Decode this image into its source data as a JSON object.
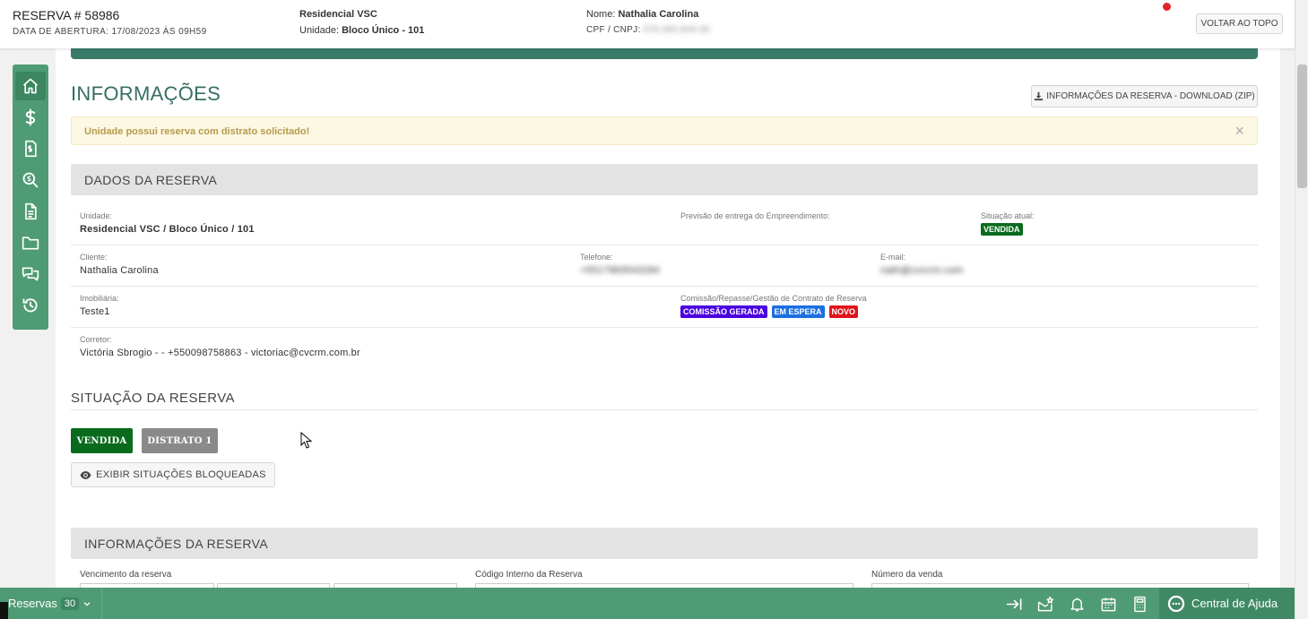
{
  "header": {
    "reserva_title": "RESERVA # 58986",
    "data_abertura": "DATA DE ABERTURA: 17/08/2023 ÀS 09H59",
    "empreendimento": "Residencial VSC",
    "unidade_label": "Unidade:",
    "unidade_value": "Bloco Único - 101",
    "nome_label": "Nome:",
    "nome_value": "Nathalia Carolina",
    "cpf_label": "CPF / CNPJ:",
    "cpf_value": "078.450.849-30",
    "voltar_label": "VOLTAR AO TOPO"
  },
  "sidebar": {
    "items": [
      {
        "name": "home-icon",
        "active": true
      },
      {
        "name": "dollar-icon",
        "active": false
      },
      {
        "name": "invoice-icon",
        "active": false
      },
      {
        "name": "search-dollar-icon",
        "active": false
      },
      {
        "name": "document-icon",
        "active": false
      },
      {
        "name": "folder-icon",
        "active": false
      },
      {
        "name": "chat-icon",
        "active": false
      },
      {
        "name": "history-icon",
        "active": false
      }
    ]
  },
  "main": {
    "title": "INFORMAÇÕES",
    "download_label": "INFORMAÇÕES DA RESERVA - DOWNLOAD (ZIP)",
    "alert_text": "Unidade possui reserva com distrato solicitado!",
    "alert_close": "×"
  },
  "dados": {
    "section_title": "DADOS DA RESERVA",
    "unidade_label": "Unidade:",
    "unidade_value": "Residencial VSC / Bloco Único / 101",
    "previsao_label": "Previsão de entrega do Empreendimento:",
    "situacao_label": "Situação atual:",
    "situacao_badge": "VENDIDA",
    "cliente_label": "Cliente:",
    "cliente_value": "Nathalia Carolina",
    "telefone_label": "Telefone:",
    "telefone_value": "+5517983543284",
    "email_label": "E-mail:",
    "email_value": "nath@cvrcrm.com",
    "imobiliaria_label": "Imobiliária:",
    "imobiliaria_value": "Teste1",
    "comissao_label": "Comissão/Repasse/Gestão de Contrato de Reserva",
    "badges": [
      {
        "text": "COMISSÃO GERADA",
        "color": "#4a00e0"
      },
      {
        "text": "EM ESPERA",
        "color": "#1b6fe0"
      },
      {
        "text": "NOVO",
        "color": "#e0141c"
      }
    ],
    "corretor_label": "Corretor:",
    "corretor_value": "Victória Sbrogio - - +550098758863 - victoriac@cvcrm.com.br"
  },
  "situacao": {
    "title": "SITUAÇÃO DA RESERVA",
    "buttons": [
      {
        "label": "VENDIDA",
        "color": "#0a6b1e"
      },
      {
        "label": "DISTRATO 1",
        "color": "#8a8a8a"
      }
    ],
    "exibir_label": "EXIBIR SITUAÇÕES BLOQUEADAS"
  },
  "informacoes": {
    "section_title": "INFORMAÇÕES DA RESERVA",
    "vencimento_label": "Vencimento da reserva",
    "codigo_label": "Código Interno da Reserva",
    "numero_label": "Número da venda"
  },
  "footer": {
    "reservas_label": "Reservas",
    "reservas_count": "30",
    "help_label": "Central de Ajuda"
  },
  "colors": {
    "primary_green": "#4f9b75",
    "title_teal": "#356e63",
    "status_green": "#0a6b1e"
  }
}
